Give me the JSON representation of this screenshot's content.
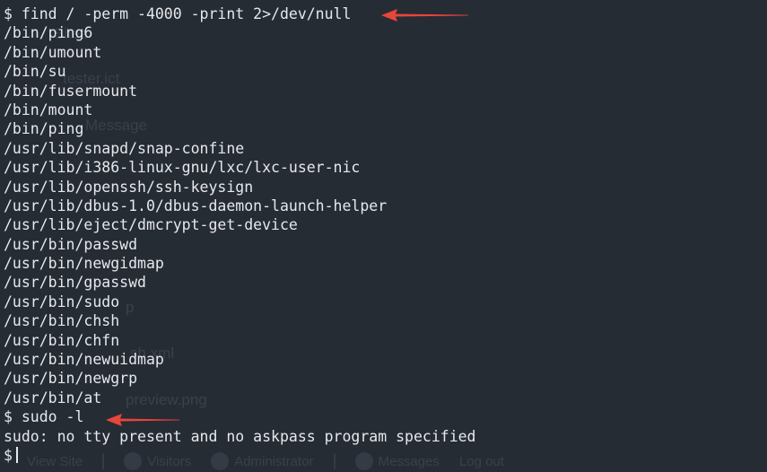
{
  "terminal": {
    "lines": [
      "$ find / -perm -4000 -print 2>/dev/null",
      "/bin/ping6",
      "/bin/umount",
      "/bin/su",
      "/bin/fusermount",
      "/bin/mount",
      "/bin/ping",
      "/usr/lib/snapd/snap-confine",
      "/usr/lib/i386-linux-gnu/lxc/lxc-user-nic",
      "/usr/lib/openssh/ssh-keysign",
      "/usr/lib/dbus-1.0/dbus-daemon-launch-helper",
      "/usr/lib/eject/dmcrypt-get-device",
      "/usr/bin/passwd",
      "/usr/bin/newgidmap",
      "/usr/bin/gpasswd",
      "/usr/bin/sudo",
      "/usr/bin/chsh",
      "/usr/bin/chfn",
      "/usr/bin/newuidmap",
      "/usr/bin/newgrp",
      "/usr/bin/at",
      "$ sudo -l",
      "sudo: no tty present and no askpass program specified"
    ],
    "prompt": "$"
  },
  "colors": {
    "background": "#262c34",
    "text": "#e6e8ec",
    "arrow": "#e8453c"
  }
}
